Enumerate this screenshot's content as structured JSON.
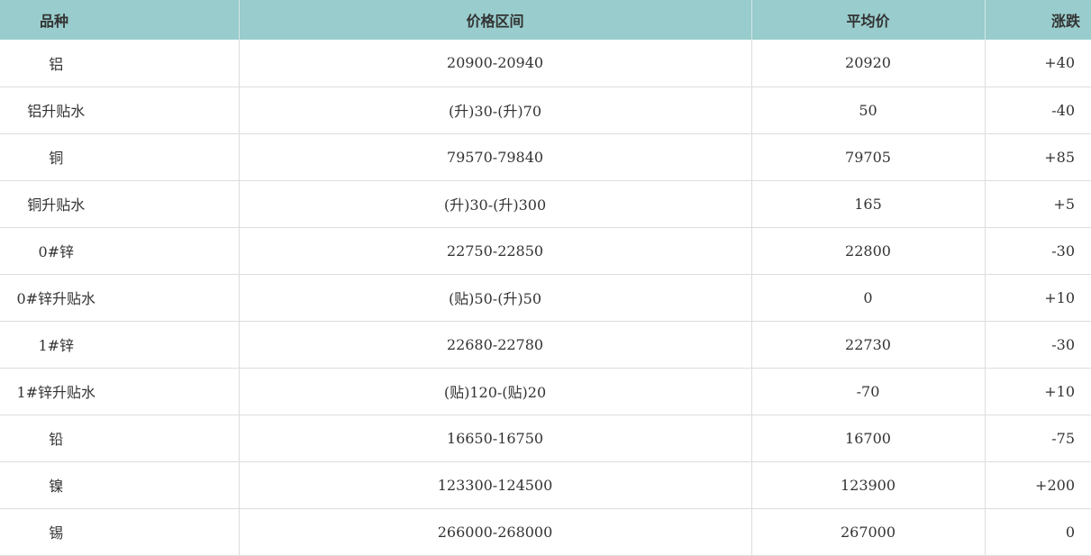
{
  "table": {
    "header": {
      "col1": "品种",
      "col2": "价格区间",
      "col3": "平均价",
      "col4": "涨跌"
    },
    "rows": [
      {
        "name": "铝",
        "range": "20900-20940",
        "avg": "20920",
        "change": "+40"
      },
      {
        "name": "铝升贴水",
        "range": "(升)30-(升)70",
        "avg": "50",
        "change": "-40"
      },
      {
        "name": "铜",
        "range": "79570-79840",
        "avg": "79705",
        "change": "+85"
      },
      {
        "name": "铜升贴水",
        "range": "(升)30-(升)300",
        "avg": "165",
        "change": "+5"
      },
      {
        "name": "0#锌",
        "range": "22750-22850",
        "avg": "22800",
        "change": "-30"
      },
      {
        "name": "0#锌升贴水",
        "range": "(贴)50-(升)50",
        "avg": "0",
        "change": "+10"
      },
      {
        "name": "1#锌",
        "range": "22680-22780",
        "avg": "22730",
        "change": "-30"
      },
      {
        "name": "1#锌升贴水",
        "range": "(贴)120-(贴)20",
        "avg": "-70",
        "change": "+10"
      },
      {
        "name": "铅",
        "range": "16650-16750",
        "avg": "16700",
        "change": "-75"
      },
      {
        "name": "镍",
        "range": "123300-124500",
        "avg": "123900",
        "change": "+200"
      },
      {
        "name": "锡",
        "range": "266000-268000",
        "avg": "267000",
        "change": "0"
      }
    ]
  },
  "colors": {
    "header_bg": "#99cccc",
    "border": "#dddddd",
    "text": "#333333"
  }
}
